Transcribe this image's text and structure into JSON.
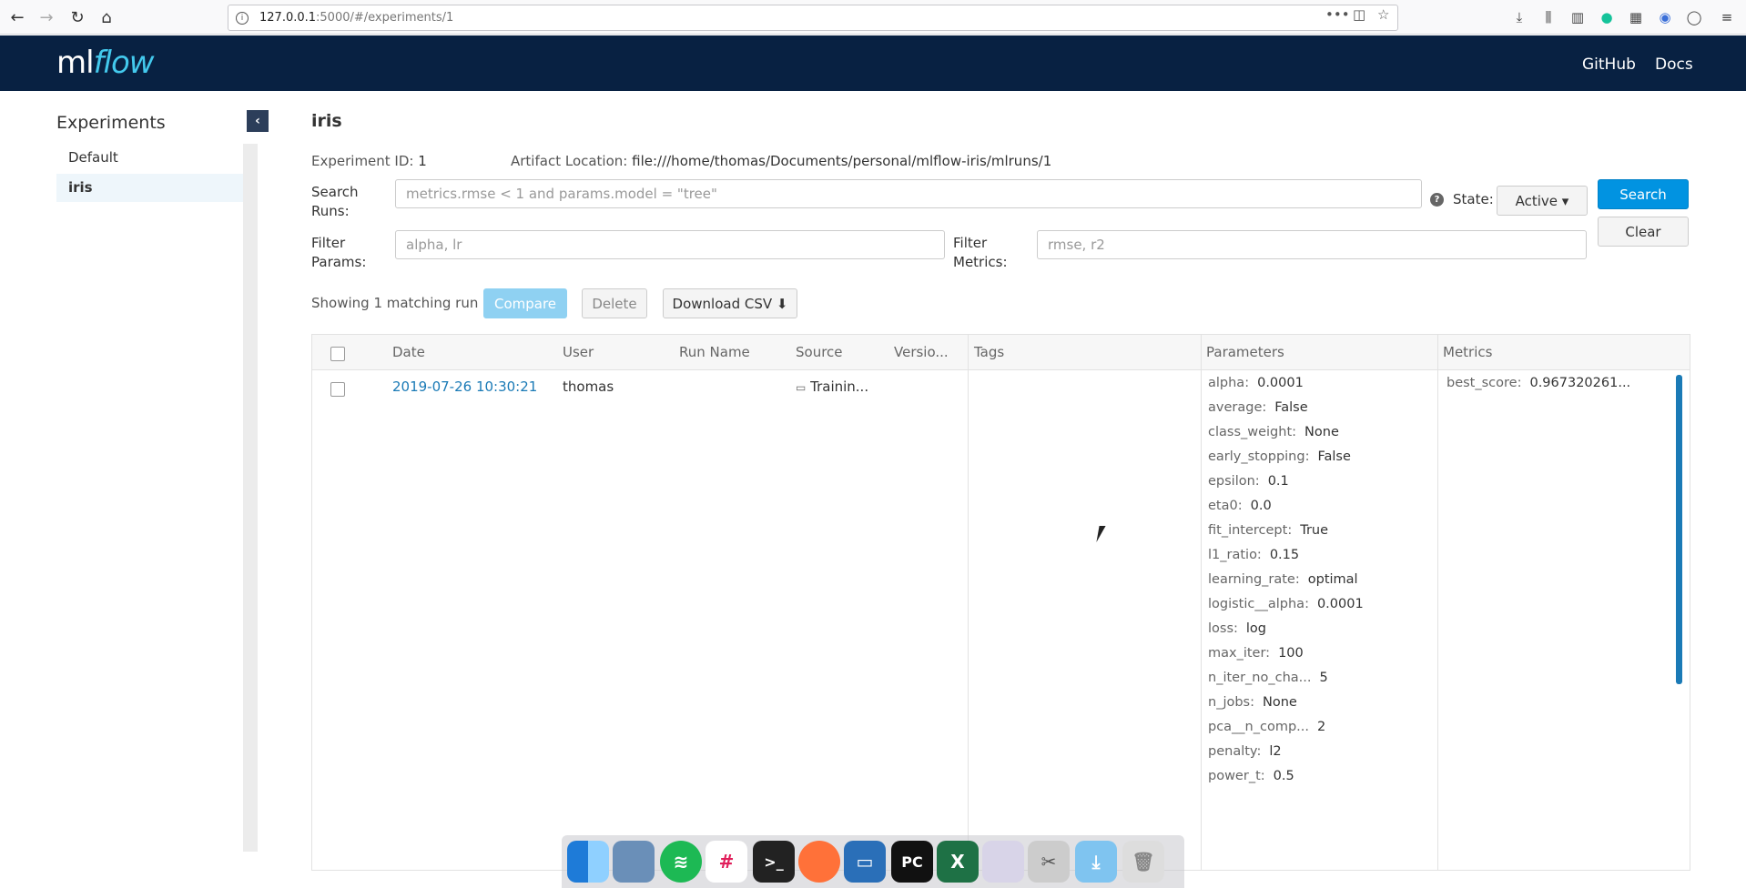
{
  "browser": {
    "url_host": "127.0.0.1",
    "url_path": ":5000/#/experiments/1",
    "url_more": "•••"
  },
  "header": {
    "logo_ml": "ml",
    "logo_flow": "flow",
    "github": "GitHub",
    "docs": "Docs"
  },
  "sidebar": {
    "title": "Experiments",
    "collapse_icon": "‹",
    "items": [
      {
        "label": "Default"
      },
      {
        "label": "iris"
      }
    ]
  },
  "experiment": {
    "title": "iris",
    "id_label": "Experiment ID:",
    "id_value": "1",
    "artifact_label": "Artifact Location:",
    "artifact_value": "file:///home/thomas/Documents/personal/mlflow-iris/mlruns/1"
  },
  "search": {
    "label_1": "Search",
    "label_2": "Runs:",
    "placeholder": "metrics.rmse < 1 and params.model = \"tree\"",
    "help": "?",
    "state_label": "State:",
    "state_value": "Active ▾",
    "search_button": "Search",
    "clear_button": "Clear"
  },
  "filters": {
    "params_label_1": "Filter",
    "params_label_2": "Params:",
    "params_placeholder": "alpha, lr",
    "metrics_label_1": "Filter",
    "metrics_label_2": "Metrics:",
    "metrics_placeholder": "rmse, r2"
  },
  "toolbar": {
    "showing": "Showing 1 matching run",
    "compare": "Compare",
    "delete": "Delete",
    "download": "Download CSV ⬇"
  },
  "table": {
    "headers": {
      "date": "Date",
      "user": "User",
      "run_name": "Run Name",
      "source": "Source",
      "version": "Versio...",
      "tags": "Tags",
      "parameters": "Parameters",
      "metrics": "Metrics"
    },
    "row": {
      "date": "2019-07-26 10:30:21",
      "user": "thomas",
      "run_name": "",
      "source": "Trainin...",
      "version": ""
    },
    "parameters": [
      {
        "k": "alpha:",
        "v": "0.0001"
      },
      {
        "k": "average:",
        "v": "False"
      },
      {
        "k": "class_weight:",
        "v": "None"
      },
      {
        "k": "early_stopping:",
        "v": "False"
      },
      {
        "k": "epsilon:",
        "v": "0.1"
      },
      {
        "k": "eta0:",
        "v": "0.0"
      },
      {
        "k": "fit_intercept:",
        "v": "True"
      },
      {
        "k": "l1_ratio:",
        "v": "0.15"
      },
      {
        "k": "learning_rate:",
        "v": "optimal"
      },
      {
        "k": "logistic__alpha:",
        "v": "0.0001"
      },
      {
        "k": "loss:",
        "v": "log"
      },
      {
        "k": "max_iter:",
        "v": "100"
      },
      {
        "k": "n_iter_no_cha...",
        "v": "5"
      },
      {
        "k": "n_jobs:",
        "v": "None"
      },
      {
        "k": "pca__n_comp...",
        "v": "2"
      },
      {
        "k": "penalty:",
        "v": "l2"
      },
      {
        "k": "power_t:",
        "v": "0.5"
      }
    ],
    "metrics": [
      {
        "k": "best_score:",
        "v": "0.967320261..."
      }
    ]
  },
  "dock": {
    "pycharm": "PC",
    "terminal": ">_",
    "excel": "X"
  }
}
